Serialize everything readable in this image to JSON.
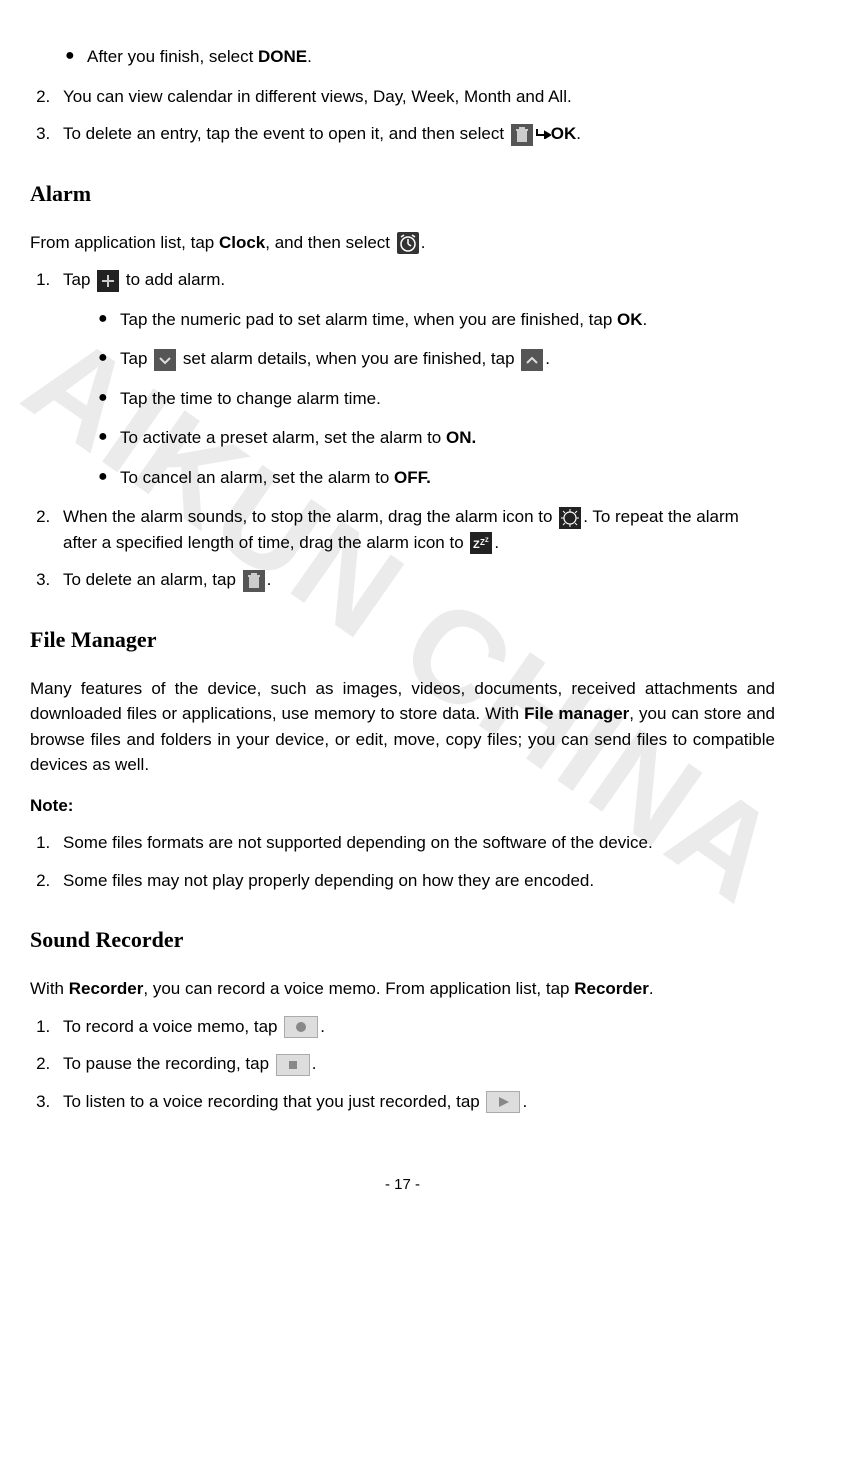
{
  "watermark": "AIKUN CHINA",
  "intro_list": {
    "bullet_done_pre": "After you finish, select ",
    "bullet_done_bold": "DONE",
    "bullet_done_post": ".",
    "item2": "You can view calendar in different views, Day, Week, Month and All.",
    "item3_pre": "To delete an entry, tap the event to open it, and then select ",
    "item3_ok": "OK",
    "item3_post": "."
  },
  "alarm": {
    "heading": "Alarm",
    "intro_pre": "From application list, tap ",
    "intro_bold": "Clock",
    "intro_mid": ", and then select ",
    "intro_post": ".",
    "step1_pre": "Tap ",
    "step1_post": " to add alarm.",
    "b1_pre": "Tap the numeric pad to set alarm time, when you are finished, tap ",
    "b1_bold": "OK",
    "b1_post": ".",
    "b2_pre": "Tap ",
    "b2_mid": " set alarm details, when you are finished, tap ",
    "b2_post": ".",
    "b3": "Tap the time to change alarm time.",
    "b4_pre": "To activate a preset alarm, set the alarm to ",
    "b4_bold": "ON.",
    "b5_pre": "To cancel an alarm, set the alarm to ",
    "b5_bold": "OFF.",
    "step2_pre": "When the alarm sounds, to stop the alarm, drag the alarm icon to ",
    "step2_mid": ". To repeat the alarm after a specified length of time, drag the alarm icon to ",
    "step2_post": ".",
    "step3_pre": "To delete an alarm, tap ",
    "step3_post": "."
  },
  "filemgr": {
    "heading": "File Manager",
    "para_pre": "Many features of the device, such as images, videos, documents, received attachments and downloaded files or applications, use memory to store data. With ",
    "para_bold": "File manager",
    "para_post": ", you can store and browse files and folders in your device, or edit, move, copy files; you can send files to compatible devices as well.",
    "note_label": "Note:",
    "note1": "Some files formats are not supported depending on the software of the device.",
    "note2": "Some files may not play properly depending on how they are encoded."
  },
  "recorder": {
    "heading": "Sound Recorder",
    "intro_pre": "With ",
    "intro_bold1": "Recorder",
    "intro_mid": ", you can record a voice memo. From application list, tap ",
    "intro_bold2": "Recorder",
    "intro_post": ".",
    "step1_pre": "To record a voice memo, tap ",
    "step1_post": ".",
    "step2_pre": "To pause the recording, tap ",
    "step2_post": ".",
    "step3_pre": "To listen to a voice recording that you just recorded, tap ",
    "step3_post": "."
  },
  "footer": "- 17 -"
}
